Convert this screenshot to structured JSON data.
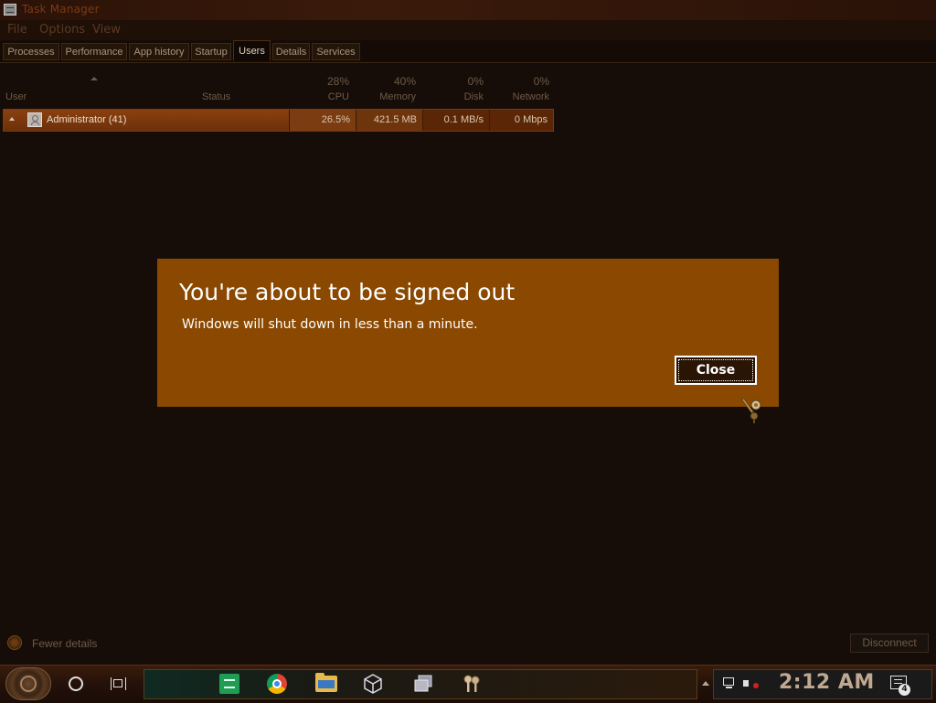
{
  "window": {
    "title": "Task Manager",
    "icon": "task-manager-icon"
  },
  "menu": [
    "File",
    "Options",
    "View"
  ],
  "tabs": [
    {
      "label": "Processes"
    },
    {
      "label": "Performance"
    },
    {
      "label": "App history"
    },
    {
      "label": "Startup"
    },
    {
      "label": "Users",
      "active": true
    },
    {
      "label": "Details"
    },
    {
      "label": "Services"
    }
  ],
  "columns": {
    "user": "User",
    "status": "Status",
    "cpu": {
      "pct": "28%",
      "label": "CPU"
    },
    "memory": {
      "pct": "40%",
      "label": "Memory"
    },
    "disk": {
      "pct": "0%",
      "label": "Disk"
    },
    "network": {
      "pct": "0%",
      "label": "Network"
    }
  },
  "users": [
    {
      "name": "Administrator (41)",
      "status": "",
      "cpu": "26.5%",
      "memory": "421.5 MB",
      "disk": "0.1 MB/s",
      "network": "0 Mbps"
    }
  ],
  "dialog": {
    "title": "You're about to be signed out",
    "message": "Windows will shut down in less than a minute.",
    "close_label": "Close"
  },
  "footer": {
    "fewer_details": "Fewer details",
    "disconnect": "Disconnect"
  },
  "taskbar": {
    "pinned": [
      "sheets-icon",
      "chrome-icon",
      "file-explorer-icon",
      "virtualbox-icon",
      "vmware-icon",
      "keys-icon"
    ],
    "clock": "2:12 AM",
    "notification_count": "4"
  },
  "colors": {
    "dialog_bg": "#8a4800",
    "row_highlight": "#8a4010",
    "background": "#160d08"
  }
}
